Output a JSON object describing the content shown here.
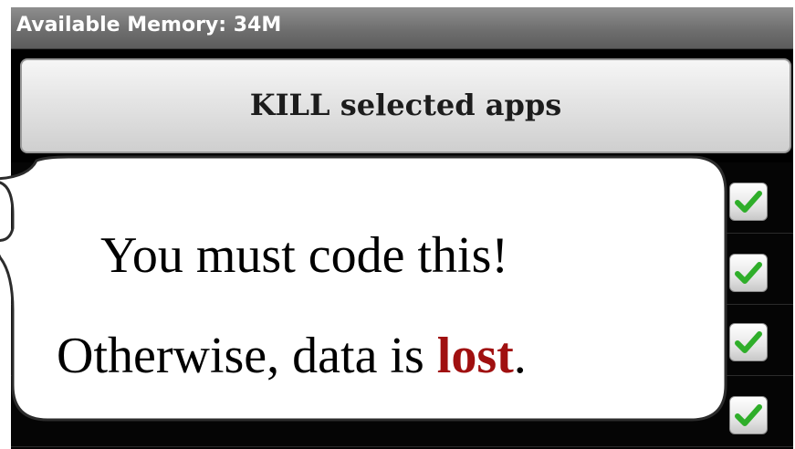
{
  "status_bar": {
    "available_memory": "Available Memory: 34M"
  },
  "kill_button": {
    "label": "KILL selected apps"
  },
  "app_list": {
    "rows": [
      {
        "checked": true
      },
      {
        "checked": true
      },
      {
        "checked": true
      },
      {
        "checked": true
      }
    ]
  },
  "callout": {
    "line1": "You must code this!",
    "line2_prefix": "Otherwise, data is ",
    "line2_emphasis": "lost",
    "line2_suffix": "."
  },
  "colors": {
    "emphasis": "#a01010",
    "check": "#2fae2a"
  },
  "icons": {
    "checkbox": "checkmark-icon"
  }
}
